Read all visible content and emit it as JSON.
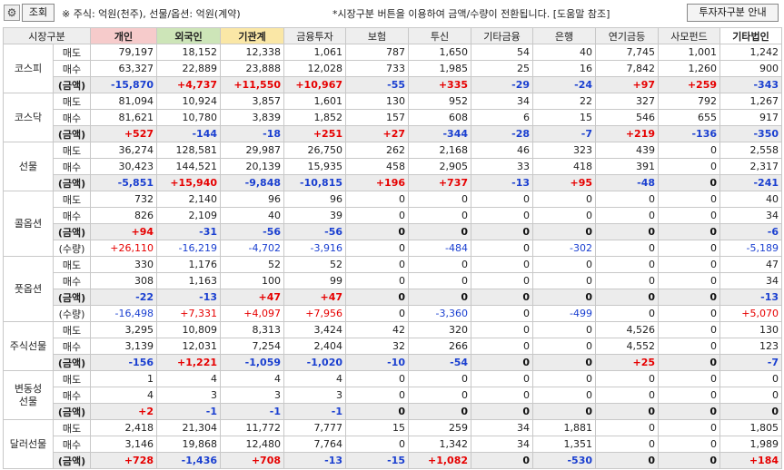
{
  "toolbar": {
    "gear": "⚙",
    "lookup_label": "조회",
    "unit_note": "※ 주식: 억원(천주), 선물/옵션: 억원(계약)",
    "switch_note": "*시장구분 버튼을 이용하여 금액/수량이 전환됩니다. [도움말 참조]",
    "help_label": "투자자구분 안내"
  },
  "headers": [
    "시장구분",
    "",
    "개인",
    "외국인",
    "기관계",
    "금융투자",
    "보험",
    "투신",
    "기타금융",
    "은행",
    "연기금등",
    "사모펀드",
    "기타법인"
  ],
  "rows": [
    {
      "market": "코스피",
      "span": 3,
      "label": "매도",
      "amt": false,
      "values": [
        "79,197",
        "18,152",
        "12,338",
        "1,061",
        "787",
        "1,650",
        "54",
        "40",
        "7,745",
        "1,001",
        "1,242"
      ]
    },
    {
      "label": "매수",
      "amt": false,
      "values": [
        "63,327",
        "22,889",
        "23,888",
        "12,028",
        "733",
        "1,985",
        "25",
        "16",
        "7,842",
        "1,260",
        "900"
      ]
    },
    {
      "label": "(금액)",
      "amt": true,
      "values": [
        "-15,870",
        "+4,737",
        "+11,550",
        "+10,967",
        "-55",
        "+335",
        "-29",
        "-24",
        "+97",
        "+259",
        "-343"
      ]
    },
    {
      "market": "코스닥",
      "span": 3,
      "label": "매도",
      "amt": false,
      "values": [
        "81,094",
        "10,924",
        "3,857",
        "1,601",
        "130",
        "952",
        "34",
        "22",
        "327",
        "792",
        "1,267"
      ]
    },
    {
      "label": "매수",
      "amt": false,
      "values": [
        "81,621",
        "10,780",
        "3,839",
        "1,852",
        "157",
        "608",
        "6",
        "15",
        "546",
        "655",
        "917"
      ]
    },
    {
      "label": "(금액)",
      "amt": true,
      "values": [
        "+527",
        "-144",
        "-18",
        "+251",
        "+27",
        "-344",
        "-28",
        "-7",
        "+219",
        "-136",
        "-350"
      ]
    },
    {
      "market": "선물",
      "span": 3,
      "label": "매도",
      "amt": false,
      "values": [
        "36,274",
        "128,581",
        "29,987",
        "26,750",
        "262",
        "2,168",
        "46",
        "323",
        "439",
        "0",
        "2,558"
      ]
    },
    {
      "label": "매수",
      "amt": false,
      "values": [
        "30,423",
        "144,521",
        "20,139",
        "15,935",
        "458",
        "2,905",
        "33",
        "418",
        "391",
        "0",
        "2,317"
      ]
    },
    {
      "label": "(금액)",
      "amt": true,
      "values": [
        "-5,851",
        "+15,940",
        "-9,848",
        "-10,815",
        "+196",
        "+737",
        "-13",
        "+95",
        "-48",
        "0",
        "-241"
      ]
    },
    {
      "market": "콜옵션",
      "span": 4,
      "label": "매도",
      "amt": false,
      "values": [
        "732",
        "2,140",
        "96",
        "96",
        "0",
        "0",
        "0",
        "0",
        "0",
        "0",
        "40"
      ]
    },
    {
      "label": "매수",
      "amt": false,
      "values": [
        "826",
        "2,109",
        "40",
        "39",
        "0",
        "0",
        "0",
        "0",
        "0",
        "0",
        "34"
      ]
    },
    {
      "label": "(금액)",
      "amt": true,
      "values": [
        "+94",
        "-31",
        "-56",
        "-56",
        "0",
        "0",
        "0",
        "0",
        "0",
        "0",
        "-6"
      ]
    },
    {
      "label": "(수량)",
      "amt": false,
      "values": [
        "+26,110",
        "-16,219",
        "-4,702",
        "-3,916",
        "0",
        "-484",
        "0",
        "-302",
        "0",
        "0",
        "-5,189"
      ]
    },
    {
      "market": "풋옵션",
      "span": 4,
      "label": "매도",
      "amt": false,
      "values": [
        "330",
        "1,176",
        "52",
        "52",
        "0",
        "0",
        "0",
        "0",
        "0",
        "0",
        "47"
      ]
    },
    {
      "label": "매수",
      "amt": false,
      "values": [
        "308",
        "1,163",
        "100",
        "99",
        "0",
        "0",
        "0",
        "0",
        "0",
        "0",
        "34"
      ]
    },
    {
      "label": "(금액)",
      "amt": true,
      "values": [
        "-22",
        "-13",
        "+47",
        "+47",
        "0",
        "0",
        "0",
        "0",
        "0",
        "0",
        "-13"
      ]
    },
    {
      "label": "(수량)",
      "amt": false,
      "values": [
        "-16,498",
        "+7,331",
        "+4,097",
        "+7,956",
        "0",
        "-3,360",
        "0",
        "-499",
        "0",
        "0",
        "+5,070"
      ]
    },
    {
      "market": "주식선물",
      "span": 3,
      "label": "매도",
      "amt": false,
      "values": [
        "3,295",
        "10,809",
        "8,313",
        "3,424",
        "42",
        "320",
        "0",
        "0",
        "4,526",
        "0",
        "130"
      ]
    },
    {
      "label": "매수",
      "amt": false,
      "values": [
        "3,139",
        "12,031",
        "7,254",
        "2,404",
        "32",
        "266",
        "0",
        "0",
        "4,552",
        "0",
        "123"
      ]
    },
    {
      "label": "(금액)",
      "amt": true,
      "values": [
        "-156",
        "+1,221",
        "-1,059",
        "-1,020",
        "-10",
        "-54",
        "0",
        "0",
        "+25",
        "0",
        "-7"
      ]
    },
    {
      "market": "변동성선물",
      "market_lines": [
        "변동성",
        "선물"
      ],
      "span": 3,
      "label": "매도",
      "amt": false,
      "values": [
        "1",
        "4",
        "4",
        "4",
        "0",
        "0",
        "0",
        "0",
        "0",
        "0",
        "0"
      ]
    },
    {
      "label": "매수",
      "amt": false,
      "values": [
        "4",
        "3",
        "3",
        "3",
        "0",
        "0",
        "0",
        "0",
        "0",
        "0",
        "0"
      ]
    },
    {
      "label": "(금액)",
      "amt": true,
      "values": [
        "+2",
        "-1",
        "-1",
        "-1",
        "0",
        "0",
        "0",
        "0",
        "0",
        "0",
        "0"
      ]
    },
    {
      "market": "달러선물",
      "span": 3,
      "label": "매도",
      "amt": false,
      "values": [
        "2,418",
        "21,304",
        "11,772",
        "7,777",
        "15",
        "259",
        "34",
        "1,881",
        "0",
        "0",
        "1,805"
      ]
    },
    {
      "label": "매수",
      "amt": false,
      "values": [
        "3,146",
        "19,868",
        "12,480",
        "7,764",
        "0",
        "1,342",
        "34",
        "1,351",
        "0",
        "0",
        "1,989"
      ]
    },
    {
      "label": "(금액)",
      "amt": true,
      "values": [
        "+728",
        "-1,436",
        "+708",
        "-13",
        "-15",
        "+1,082",
        "0",
        "-530",
        "0",
        "0",
        "+184"
      ]
    }
  ],
  "colors": {
    "positive": "#e60000",
    "negative": "#1a3fd0",
    "individual_header": "#f6cbcb",
    "foreign_header": "#cde5b8",
    "institution_header": "#fae7a6",
    "amount_row_bg": "#ececec"
  }
}
